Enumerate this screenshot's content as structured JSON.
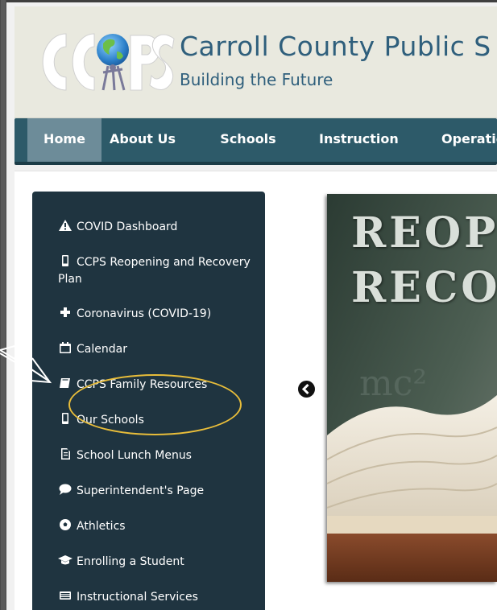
{
  "header": {
    "title": "Carroll County Public S",
    "tagline": "Building the Future",
    "logo_text": "CCPS"
  },
  "nav": {
    "items": [
      {
        "label": "Home",
        "active": true
      },
      {
        "label": "About Us"
      },
      {
        "label": "Schools"
      },
      {
        "label": "Instruction"
      },
      {
        "label": "Operatio"
      }
    ]
  },
  "sidebar": {
    "items": [
      {
        "label": "COVID Dashboard",
        "icon": "warning-icon"
      },
      {
        "label": "CCPS Reopening and Recovery Plan",
        "icon": "mobile-icon"
      },
      {
        "label": "Coronavirus (COVID-19)",
        "icon": "plus-icon"
      },
      {
        "label": "Calendar",
        "icon": "calendar-icon"
      },
      {
        "label": "CCPS Family Resources",
        "icon": "book-icon",
        "highlighted": true
      },
      {
        "label": "Our Schools",
        "icon": "mobile-icon"
      },
      {
        "label": "School Lunch Menus",
        "icon": "document-icon"
      },
      {
        "label": "Superintendent's Page",
        "icon": "comment-icon"
      },
      {
        "label": "Athletics",
        "icon": "soccer-ball-icon"
      },
      {
        "label": "Enrolling a Student",
        "icon": "graduation-cap-icon"
      },
      {
        "label": "Instructional Services",
        "icon": "list-icon"
      }
    ]
  },
  "slideshow": {
    "line1": "REOPE",
    "line2": "RECOV"
  },
  "colors": {
    "header_title": "#2f5f7c",
    "nav_bg": "#2d5a69",
    "nav_active": "#6d8c99",
    "sidebar_bg": "#1f3440",
    "highlight_ring": "#e8bd3a"
  }
}
